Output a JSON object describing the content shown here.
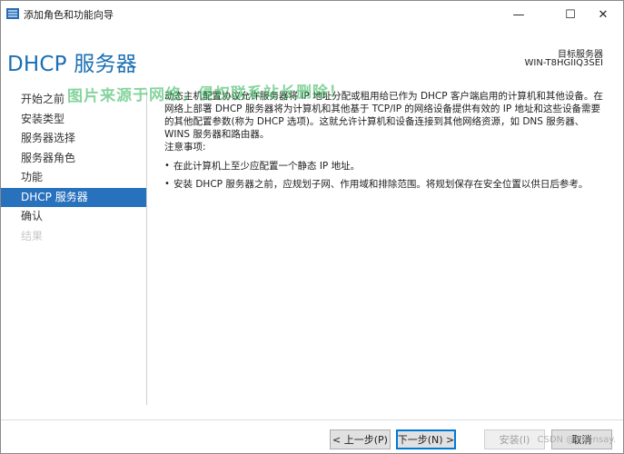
{
  "window": {
    "title": "添加角色和功能向导",
    "minimize_glyph": "—",
    "maximize_glyph": "☐",
    "close_glyph": "✕"
  },
  "header": {
    "page_title": "DHCP 服务器",
    "target_label": "目标服务器",
    "target_name": "WIN-T8HGIIQ3SEI"
  },
  "watermark": "图片来源于网络，侵权联系站长删除！",
  "nav": {
    "items": [
      {
        "label": "开始之前",
        "state": "normal"
      },
      {
        "label": "安装类型",
        "state": "normal"
      },
      {
        "label": "服务器选择",
        "state": "normal"
      },
      {
        "label": "服务器角色",
        "state": "normal"
      },
      {
        "label": "功能",
        "state": "normal"
      },
      {
        "label": "DHCP 服务器",
        "state": "active"
      },
      {
        "label": "确认",
        "state": "normal"
      },
      {
        "label": "结果",
        "state": "disabled"
      }
    ]
  },
  "content": {
    "intro_1": "动态主机配置协议允许服务器将 IP 地址分配或租用给已作为 DHCP 客户端启用的计算机和其他设备。在",
    "intro_2": "网络上部署 DHCP 服务器将为计算机和其他基于 TCP/IP 的网络设备提供有效的 IP 地址和这些设备需要",
    "intro_3": "的其他配置参数(称为 DHCP 选项)。这就允许计算机和设备连接到其他网络资源，如 DNS 服务器、",
    "intro_4": "WINS 服务器和路由器。",
    "notes_heading": "注意事项:",
    "notes": [
      "在此计算机上至少应配置一个静态 IP 地址。",
      "安装 DHCP 服务器之前，应规划子网、作用域和排除范围。将规划保存在安全位置以供日后参考。"
    ]
  },
  "footer": {
    "prev_label": "< 上一步(P)",
    "next_label": "下一步(N) >",
    "install_label": "安装(I)",
    "cancel_label": "取消",
    "csdn_mark": "CSDN @Chensay."
  },
  "colors": {
    "accent": "#2771bd",
    "title_blue": "#1a6fb3",
    "watermark_green": "#22b14c"
  }
}
